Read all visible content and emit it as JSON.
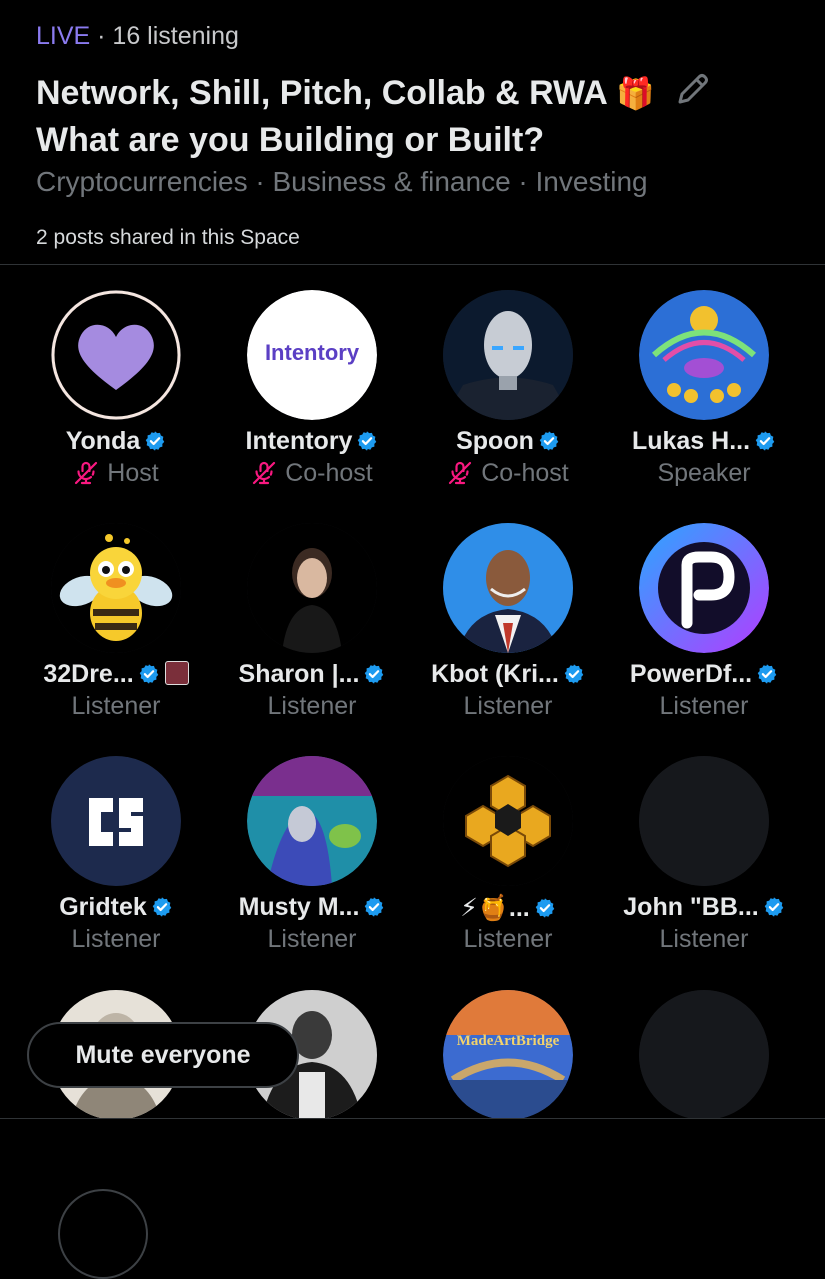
{
  "header": {
    "live_label": "LIVE",
    "separator": " · ",
    "listening": "16 listening",
    "title_line1": "Network, Shill, Pitch, Collab & RWA",
    "title_emoji": "🎁",
    "title_line2": "What are you Building or Built?",
    "topics": "Cryptocurrencies · Business & finance · Investing",
    "posts_shared": "2 posts shared in this Space"
  },
  "participants": [
    {
      "name": "Yonda",
      "role": "Host",
      "muted": true,
      "verified": true,
      "avatar": "heart-avatar"
    },
    {
      "name": "Intentory",
      "role": "Co-host",
      "muted": true,
      "verified": true,
      "avatar": "intentory-logo",
      "avatar_text": "Intentory"
    },
    {
      "name": "Spoon",
      "role": "Co-host",
      "muted": true,
      "verified": true,
      "avatar": "android-avatar"
    },
    {
      "name": "Lukas H...",
      "role": "Speaker",
      "muted": false,
      "verified": true,
      "avatar": "mandala-avatar"
    },
    {
      "name": "32Dre...",
      "role": "Listener",
      "verified": true,
      "avatar": "bee-duck-avatar",
      "badge": "pixel-badge"
    },
    {
      "name": "Sharon |...",
      "role": "Listener",
      "verified": true,
      "avatar": "portrait-avatar"
    },
    {
      "name": "Kbot (Kri...",
      "role": "Listener",
      "verified": true,
      "avatar": "man-avatar"
    },
    {
      "name": "PowerDf...",
      "role": "Listener",
      "verified": true,
      "avatar": "p-logo-avatar"
    },
    {
      "name": "Gridtek",
      "role": "Listener",
      "verified": true,
      "avatar": "gridtek-logo"
    },
    {
      "name": "Musty M...",
      "role": "Listener",
      "verified": true,
      "avatar": "art-avatar"
    },
    {
      "name": "⚡🍯...",
      "role": "Listener",
      "verified": true,
      "avatar": "honeycomb-avatar"
    },
    {
      "name": "John \"BB...",
      "role": "Listener",
      "verified": true,
      "avatar": "blank-avatar"
    }
  ],
  "bottom_row": [
    {
      "avatar": "bust-avatar"
    },
    {
      "avatar": "bw-man-avatar"
    },
    {
      "avatar": "madeartbridge-avatar",
      "avatar_text": "MadeArtBridge"
    },
    {
      "avatar": "blank-avatar"
    }
  ],
  "actions": {
    "mute_everyone": "Mute everyone"
  },
  "colors": {
    "live": "#8b7bf0",
    "verified": "#1d9bf0",
    "muted": "#f91880",
    "secondary_text": "#71767b",
    "background": "#000000"
  }
}
